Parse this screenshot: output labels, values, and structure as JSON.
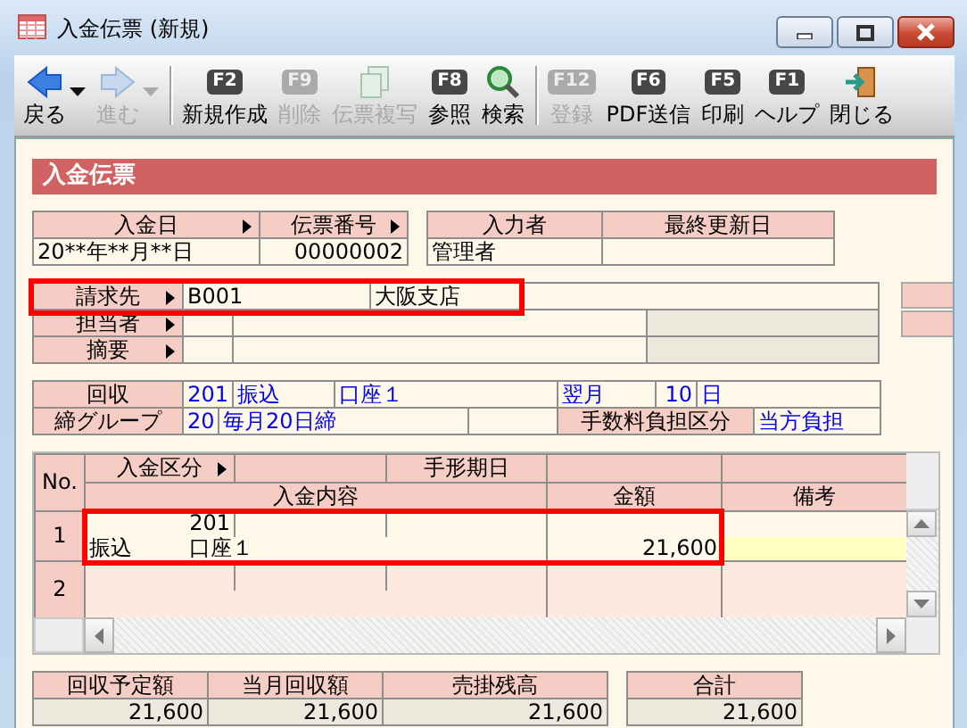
{
  "window": {
    "title": "入金伝票 (新規)"
  },
  "toolbar": [
    {
      "kind": "back",
      "label": "戻る",
      "disabled": false,
      "menu": true
    },
    {
      "kind": "forward",
      "label": "進む",
      "disabled": true,
      "menu": true
    },
    {
      "kind": "separator"
    },
    {
      "kind": "key",
      "key": "F2",
      "label": "新規作成",
      "disabled": false
    },
    {
      "kind": "key",
      "key": "F9",
      "label": "削除",
      "disabled": true
    },
    {
      "kind": "copy",
      "label": "伝票複写",
      "disabled": true
    },
    {
      "kind": "key",
      "key": "F8",
      "label": "参照",
      "disabled": false
    },
    {
      "kind": "search",
      "label": "検索",
      "disabled": false
    },
    {
      "kind": "separator"
    },
    {
      "kind": "key",
      "key": "F12",
      "label": "登録",
      "disabled": true
    },
    {
      "kind": "key",
      "key": "F6",
      "label": "PDF送信",
      "disabled": false
    },
    {
      "kind": "key",
      "key": "F5",
      "label": "印刷",
      "disabled": false
    },
    {
      "kind": "key",
      "key": "F1",
      "label": "ヘルプ",
      "disabled": false
    },
    {
      "kind": "exit",
      "label": "閉じる",
      "disabled": false
    }
  ],
  "section_title": "入金伝票",
  "slip": [
    {
      "label": "入金日",
      "lookup": true,
      "value": "20**年**月**日"
    },
    {
      "label": "伝票番号",
      "lookup": true,
      "value": "00000002"
    }
  ],
  "author": [
    {
      "label": "入力者",
      "value": "管理者"
    },
    {
      "label": "最終更新日"
    }
  ],
  "customer": {
    "rows": [
      {
        "kind": "customer",
        "label": "請求先",
        "lookup": true,
        "code": "B001",
        "name": "大阪支店",
        "highlighted": true
      },
      {
        "kind": "plain",
        "label": "担当者",
        "lookup": true
      },
      {
        "kind": "plain",
        "label": "摘要",
        "lookup": true
      }
    ]
  },
  "collection": {
    "label": "回収",
    "code": "201",
    "method": "振込",
    "account": "口座１",
    "month": "翌月",
    "day": "10",
    "day_unit": "日"
  },
  "closing": {
    "label": "締グループ",
    "code": "20",
    "name": "毎月20日締",
    "fee_label": "手数料負担区分",
    "fee": "当方負担"
  },
  "line_columns": {
    "no": "No.",
    "type": "入金区分",
    "due_date": "手形期日",
    "content": "入金内容",
    "amount": "金額",
    "note": "備考"
  },
  "lines": [
    {
      "no": "1",
      "code": "201",
      "method": "振込",
      "account": "口座１",
      "amount": "21,600",
      "highlighted": true,
      "note_focused": true
    },
    {
      "no": "2",
      "highlighted": false,
      "note_focused": false
    }
  ],
  "totals": [
    {
      "label": "回収予定額",
      "value": "21,600"
    },
    {
      "label": "当月回収額",
      "value": "21,600"
    },
    {
      "label": "売掛残高",
      "value": "21,600"
    }
  ],
  "grand_total": {
    "label": "合計",
    "value": "21,600"
  }
}
